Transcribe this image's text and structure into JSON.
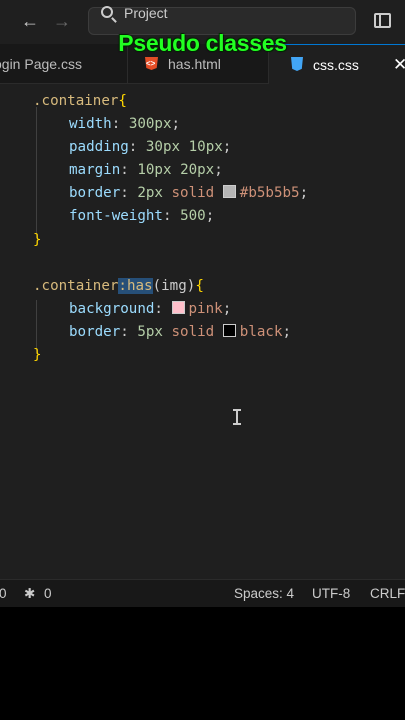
{
  "titlebar": {
    "back_icon": "arrow-left-icon",
    "forward_icon": "arrow-right-icon",
    "search_text": "Project",
    "layout_icon": "layout-sidebar-icon"
  },
  "overlay_caption": "Pseudo classes",
  "tabs": [
    {
      "label": "Login Page.css",
      "visible": "ogin Page.css",
      "icon": "css-file-icon",
      "active": false
    },
    {
      "label": "has.html",
      "icon": "html-file-icon",
      "active": false
    },
    {
      "label": "css.css",
      "icon": "css-file-icon",
      "active": true
    }
  ],
  "code": {
    "l1_selector": ".container",
    "brace_open": "{",
    "brace_close": "}",
    "l2_prop": "width",
    "l2_val": "300px",
    "l3_prop": "padding",
    "l3_val1": "30px",
    "l3_val2": "10px",
    "l4_prop": "margin",
    "l4_val1": "10px",
    "l4_val2": "20px",
    "l5_prop": "border",
    "l5_val1": "2px",
    "l5_val2": "solid",
    "l5_color": "#b5b5b5",
    "l6_prop": "font-weight",
    "l6_val": "500",
    "l9_selector": ".container",
    "l9_pseudo": ":has",
    "l9_arg": "(img)",
    "l10_prop": "background",
    "l10_val": "pink",
    "l11_prop": "border",
    "l11_val1": "5px",
    "l11_val2": "solid",
    "l11_color": "black"
  },
  "swatch_colors": {
    "b5b5b5": "#b5b5b5",
    "pink": "#ffc0cb",
    "black": "#000000"
  },
  "statusbar": {
    "errors": "0",
    "ports_icon": "broadcast-icon",
    "ports": "0",
    "spaces": "Spaces: 4",
    "encoding": "UTF-8",
    "eol": "CRLF"
  }
}
